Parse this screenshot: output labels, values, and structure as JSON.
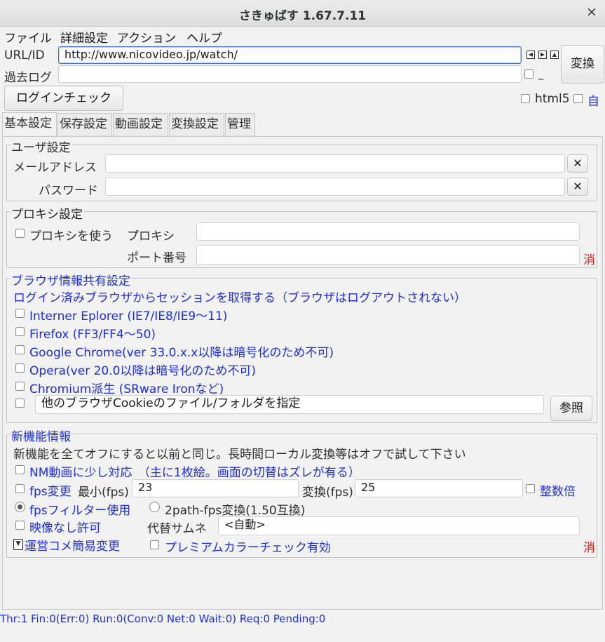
{
  "window": {
    "title": "さきゅばす 1.67.7.11",
    "close_glyph": "×"
  },
  "menu": [
    "ファイル",
    "詳細設定",
    "アクション",
    "ヘルプ"
  ],
  "top": {
    "url_label": "URL/ID",
    "url_value": "http://www.nicovideo.jp/watch/",
    "past_log_label": "過去ログ",
    "past_log_value": "",
    "past_log_suffix": "_",
    "convert_button": "変換",
    "login_check_button": "ログインチェック",
    "html5_label": "html5",
    "auto_label": "自"
  },
  "tabs": [
    "基本設定",
    "保存設定",
    "動画設定",
    "変換設定",
    "管理"
  ],
  "user_settings": {
    "title": "ユーザ設定",
    "email_label": "メールアドレス",
    "email_value": "",
    "password_label": "パスワード",
    "password_value": "",
    "clear_glyph": "✕"
  },
  "proxy_settings": {
    "title": "プロキシ設定",
    "use_proxy_label": "プロキシを使う",
    "proxy_label": "プロキシ",
    "proxy_value": "",
    "port_label": "ポート番号",
    "port_value": "",
    "clear_label": "消"
  },
  "browser_settings": {
    "title": "ブラウザ情報共有設定",
    "description": "ログイン済みブラウザからセッションを取得する（ブラウザはログアウトされない）",
    "browsers": [
      "Interner Eplorer (IE7/IE8/IE9～11)",
      "Firefox (FF3/FF4～50)",
      "Google Chrome(ver 33.0.x.x以降は暗号化のため不可)",
      "Opera(ver 20.0以降は暗号化のため不可)",
      "Chromium派生 (SRware Ironなど)"
    ],
    "other_browser_value": "他のブラウザCookieのファイル/フォルダを指定",
    "browse_button": "参照"
  },
  "new_features": {
    "title": "新機能情報",
    "description": "新機能を全てオフにすると以前と同じ。長時間ローカル変換等はオフで試して下さい",
    "nm_label": "NM動画に少し対応　（主に1枚絵。画面の切替はズレが有る）",
    "fps_change_label": "fps変更",
    "min_fps_label": "最小(fps)",
    "min_fps_value": "23",
    "conv_fps_label": "変換(fps)",
    "conv_fps_value": "25",
    "integer_multiple_label": "整数倍",
    "fps_filter_label": "fpsフィルター使用",
    "two_path_label": "2path-fps変換(1.50互換)",
    "no_video_label": "映像なし許可",
    "alt_thumb_label": "代替サムネ",
    "alt_thumb_value": "<自動>",
    "official_comment_label": "運営コメ簡易変更",
    "premium_color_label": "プレミアムカラーチェック有効",
    "clear_label": "消"
  },
  "status_bar": "Thr:1 Fin:0(Err:0) Run:0(Conv:0 Net:0 Wait:0) Req:0 Pending:0",
  "colors": {
    "link_blue": "#1c2ee0",
    "warning_red": "#d0201a",
    "background": "#f2f2f2"
  },
  "icons": [
    "close-icon",
    "spin-left-icon",
    "spin-right-icon",
    "spin-up-icon",
    "dropdown-arrow-icon"
  ]
}
